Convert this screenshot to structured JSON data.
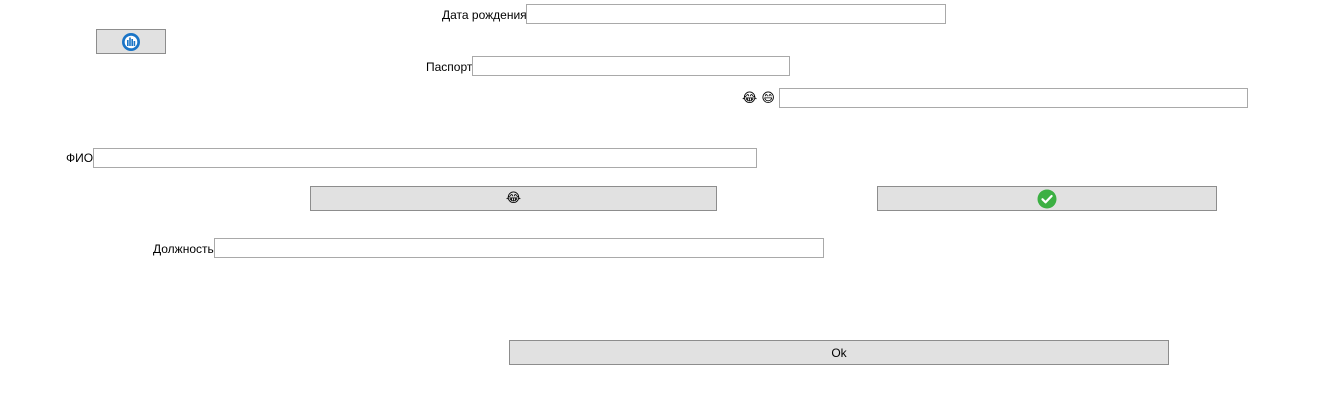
{
  "fields": {
    "birth_date": {
      "label": "Дата рождения",
      "value": ""
    },
    "passport": {
      "label": "Паспорт",
      "value": ""
    },
    "emoji_field": {
      "label": "😂 😄",
      "value": ""
    },
    "full_name": {
      "label": "ФИО",
      "value": ""
    },
    "position": {
      "label": "Должность",
      "value": ""
    }
  },
  "buttons": {
    "top_icon_button": {
      "icon": "app-logo-icon"
    },
    "emoji_button": {
      "label": "😂"
    },
    "check_button": {
      "icon": "green-check-icon"
    },
    "ok_button": {
      "label": "Ok"
    }
  },
  "colors": {
    "logo_blue": "#1a74c6",
    "check_green": "#3cb043",
    "button_face": "#e1e1e1",
    "border": "#a9a9a9"
  }
}
